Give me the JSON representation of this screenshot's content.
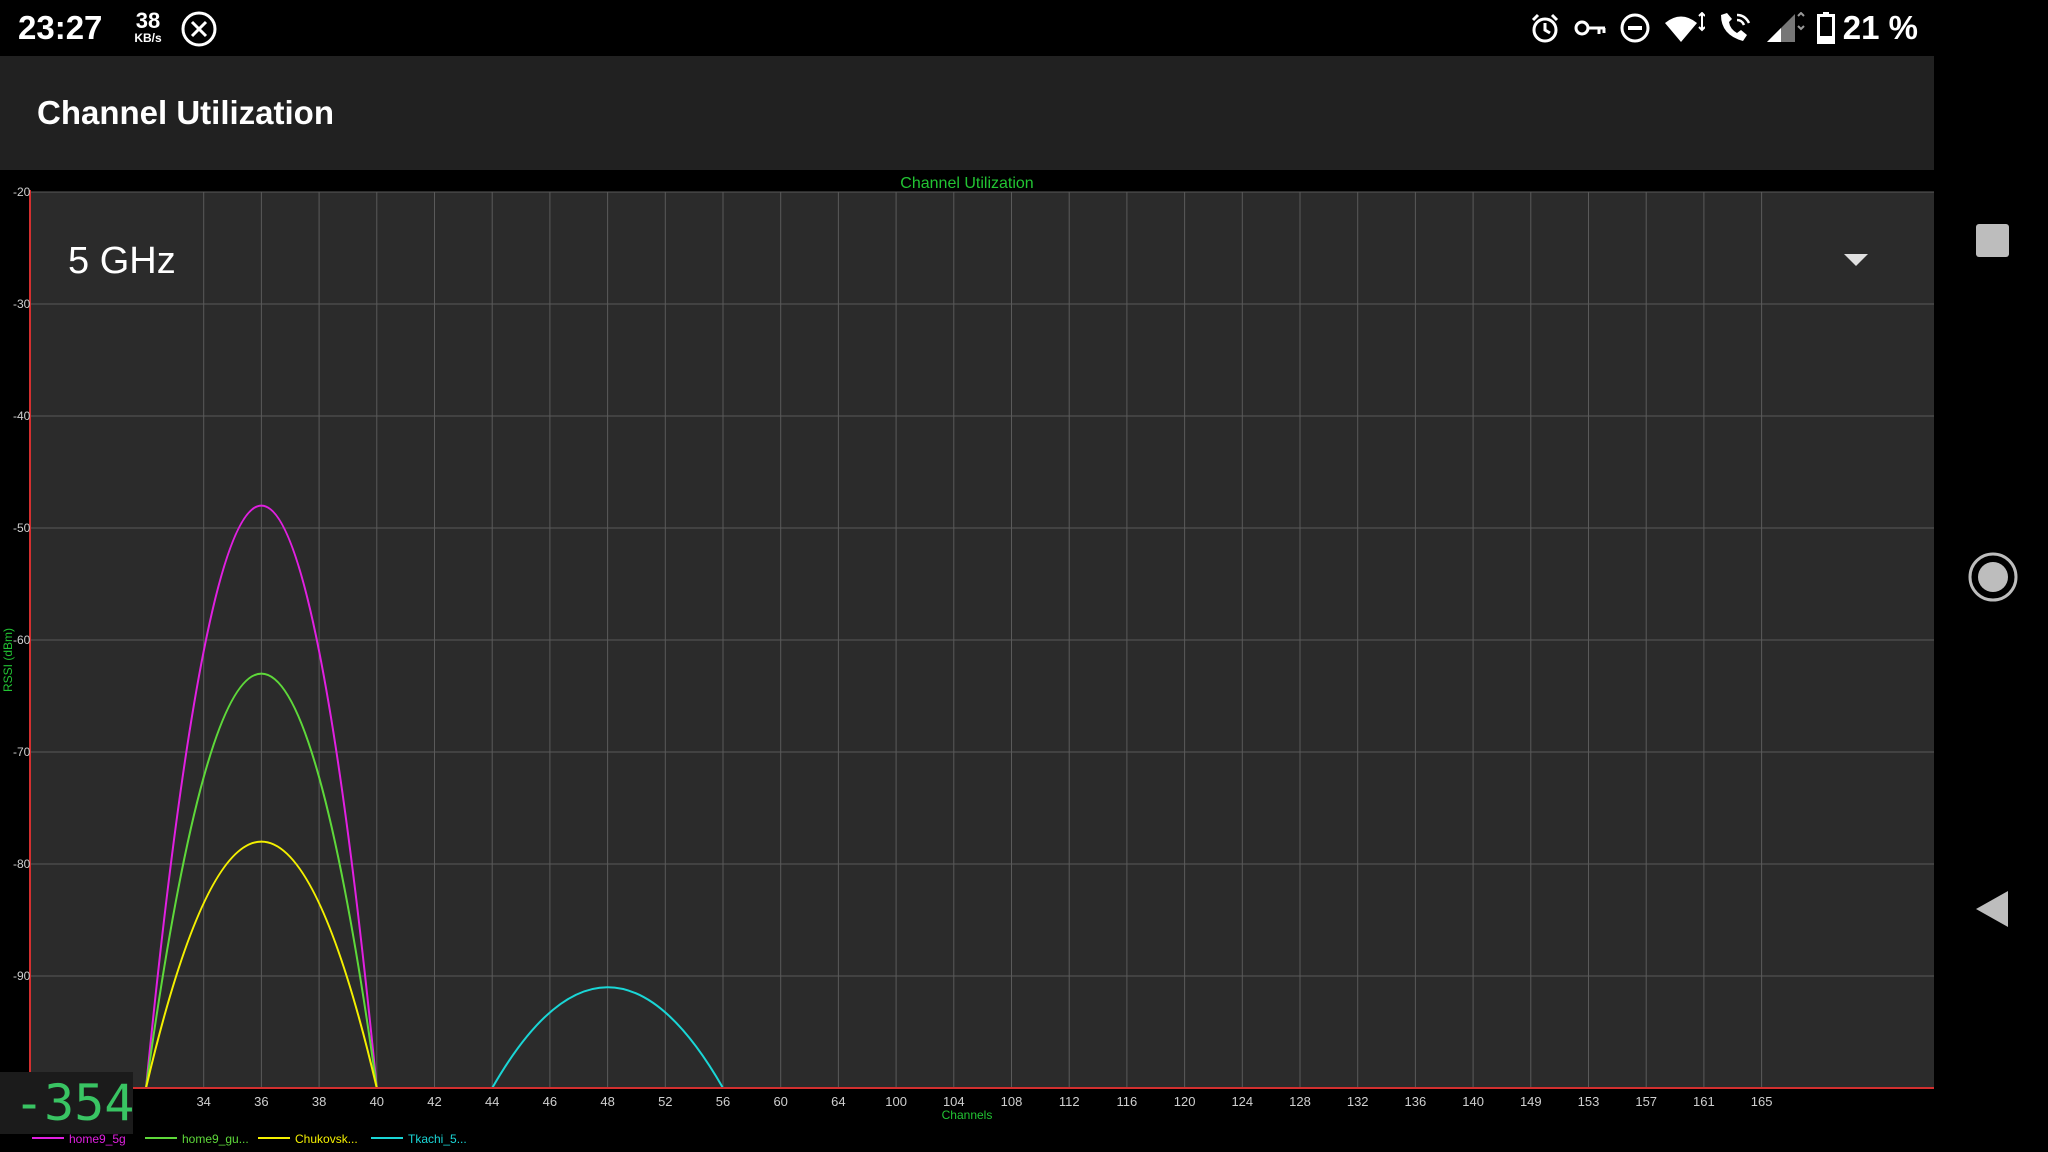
{
  "status_bar": {
    "time": "23:27",
    "net_speed_value": "38",
    "net_speed_unit": "KB/s",
    "battery_percent": "21 %",
    "left_icons": [
      "close-circle-icon"
    ],
    "right_icons": [
      "alarm-icon",
      "vpn-key-icon",
      "do-not-disturb-icon",
      "wifi-icon",
      "wifi-calling-icon",
      "cell-signal-icon",
      "battery-icon"
    ]
  },
  "toolbar": {
    "title": "Channel Utilization"
  },
  "band_selector": {
    "value": "5 GHz",
    "icon": "dropdown-arrow-icon"
  },
  "live_counter": "-354",
  "nav_bar": {
    "icons": [
      "recents-square-icon",
      "home-circle-icon",
      "back-triangle-icon"
    ]
  },
  "colors": {
    "grid": "#5a5a5a",
    "plot_background": "#2b2b2b",
    "axis": "#d32f2f",
    "label_green": "#22c433"
  },
  "chart_data": {
    "type": "line",
    "title": "Channel Utilization",
    "xlabel": "Channels",
    "ylabel": "RSSI (dBm)",
    "ylim": [
      -100,
      -20
    ],
    "yticks": [
      -20,
      -30,
      -40,
      -50,
      -60,
      -70,
      -80,
      -90,
      -100
    ],
    "xticks": [
      "34",
      "36",
      "38",
      "40",
      "42",
      "44",
      "46",
      "48",
      "52",
      "56",
      "60",
      "64",
      "100",
      "104",
      "108",
      "112",
      "116",
      "120",
      "124",
      "128",
      "132",
      "136",
      "140",
      "149",
      "153",
      "157",
      "161",
      "165"
    ],
    "grid": true,
    "legend_position": "bottom-left",
    "series": [
      {
        "name": "home9_5g",
        "color": "#e020e0",
        "center_channel": "36",
        "peak_dbm": -48,
        "span_channels": [
          "32",
          "40"
        ]
      },
      {
        "name": "home9_gu...",
        "color": "#5ed83a",
        "center_channel": "36",
        "peak_dbm": -63,
        "span_channels": [
          "32",
          "40"
        ]
      },
      {
        "name": "Chukovsk...",
        "color": "#f4f000",
        "center_channel": "36",
        "peak_dbm": -78,
        "span_channels": [
          "32",
          "40"
        ]
      },
      {
        "name": "Tkachi_5...",
        "color": "#1ad6d6",
        "center_channel": "48",
        "peak_dbm": -91,
        "span_channels": [
          "44",
          "56"
        ]
      }
    ]
  }
}
